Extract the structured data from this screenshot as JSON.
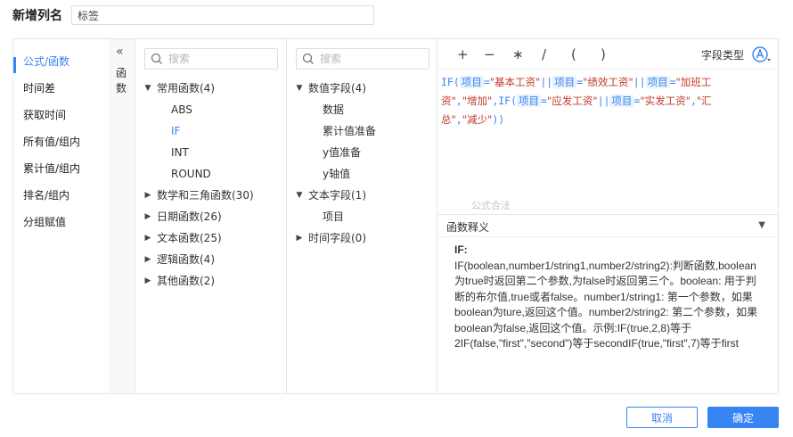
{
  "header": {
    "label": "新增列名",
    "column_name": "标签"
  },
  "categories": [
    {
      "label": "公式/函数",
      "active": true
    },
    {
      "label": "时间差"
    },
    {
      "label": "获取时间"
    },
    {
      "label": "所有值/组内"
    },
    {
      "label": "累计值/组内"
    },
    {
      "label": "排名/组内"
    },
    {
      "label": "分组赋值"
    }
  ],
  "collapse": {
    "label": "函数"
  },
  "functions": {
    "search_placeholder": "搜索",
    "groups": [
      {
        "label": "常用函数(4)",
        "expanded": true,
        "children": [
          "ABS",
          "IF",
          "INT",
          "ROUND"
        ],
        "selected": "IF"
      },
      {
        "label": "数学和三角函数(30)"
      },
      {
        "label": "日期函数(26)"
      },
      {
        "label": "文本函数(25)"
      },
      {
        "label": "逻辑函数(4)"
      },
      {
        "label": "其他函数(2)"
      }
    ]
  },
  "fields": {
    "search_placeholder": "搜索",
    "groups": [
      {
        "label": "数值字段(4)",
        "expanded": true,
        "children": [
          "数据",
          "累计值准备",
          "y值准备",
          "y轴值"
        ]
      },
      {
        "label": "文本字段(1)",
        "expanded": true,
        "children": [
          "项目"
        ]
      },
      {
        "label": "时间字段(0)"
      }
    ]
  },
  "toolbar": {
    "ops": [
      "+",
      "−",
      "∗",
      "/",
      "(",
      ")"
    ],
    "field_type_label": "字段类型",
    "field_type_icon": "font-a-icon"
  },
  "formula": {
    "tokens": [
      {
        "t": "fn",
        "v": "IF("
      },
      {
        "t": "fld",
        "v": "项目"
      },
      {
        "t": "fn",
        "v": "="
      },
      {
        "t": "str",
        "v": "\"基本工资\""
      },
      {
        "t": "fn",
        "v": "||"
      },
      {
        "t": "fld",
        "v": "项目"
      },
      {
        "t": "fn",
        "v": "="
      },
      {
        "t": "str",
        "v": "\"绩效工资\""
      },
      {
        "t": "fn",
        "v": "||"
      },
      {
        "t": "fld",
        "v": "项目"
      },
      {
        "t": "fn",
        "v": "="
      },
      {
        "t": "str",
        "v": "\"加班工资\""
      },
      {
        "t": "fn",
        "v": ","
      },
      {
        "t": "str",
        "v": "\"增加\""
      },
      {
        "t": "fn",
        "v": ",IF("
      },
      {
        "t": "fld",
        "v": "项目"
      },
      {
        "t": "fn",
        "v": "="
      },
      {
        "t": "str",
        "v": "\"应发工资\""
      },
      {
        "t": "fn",
        "v": "||"
      },
      {
        "t": "fld",
        "v": "项目"
      },
      {
        "t": "fn",
        "v": "="
      },
      {
        "t": "str",
        "v": "\"实发工资\""
      },
      {
        "t": "fn",
        "v": ","
      },
      {
        "t": "str",
        "v": "\"汇总\""
      },
      {
        "t": "fn",
        "v": ","
      },
      {
        "t": "str",
        "v": "\"减少\""
      },
      {
        "t": "fn",
        "v": "))"
      }
    ],
    "status": "公式合法"
  },
  "explanation": {
    "title": "函数释义",
    "name": "IF:",
    "text": "IF(boolean,number1/string1,number2/string2):判断函数,boolean为true时返回第二个参数,为false时返回第三个。boolean: 用于判断的布尔值,true或者false。number1/string1: 第一个参数，如果boolean为ture,返回这个值。number2/string2: 第二个参数，如果boolean为false,返回这个值。示例:IF(true,2,8)等于2IF(false,\"first\",\"second\")等于secondIF(true,\"first\",7)等于first"
  },
  "buttons": {
    "cancel": "取消",
    "ok": "确定"
  },
  "colors": {
    "accent": "#3685f2",
    "string": "#c0392b"
  }
}
